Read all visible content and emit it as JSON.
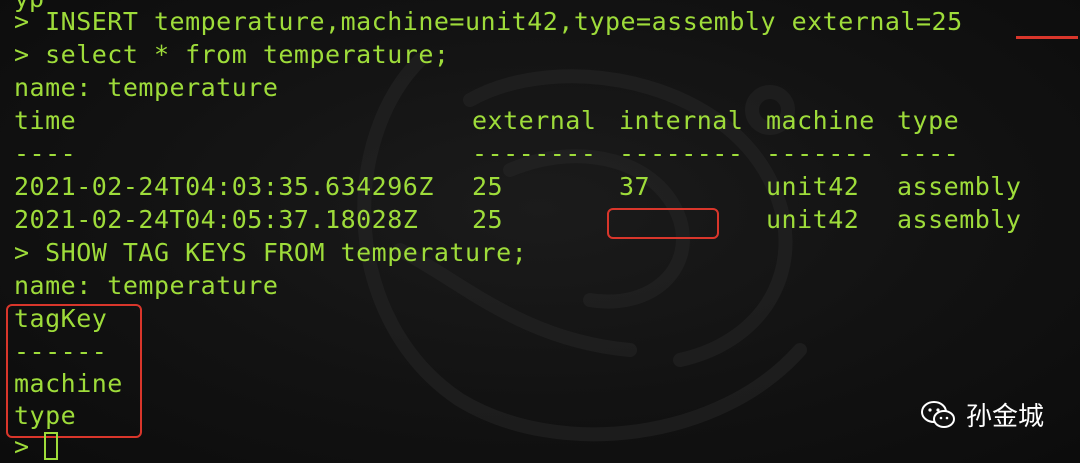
{
  "terminal": {
    "top_partial": "yp",
    "lines": {
      "insert": "> INSERT temperature,machine=unit42,type=assembly external=25",
      "select": "> select * from temperature;",
      "name1": "name: temperature",
      "show": "> SHOW TAG KEYS FROM temperature;",
      "name2": "name: temperature",
      "tagkey_header": "tagKey",
      "tagkey_sep": "------",
      "tagkey_row1": "machine",
      "tagkey_row2": "type",
      "prompt": ">"
    },
    "table": {
      "headers": {
        "time": "time",
        "external": "external",
        "internal": "internal",
        "machine": "machine",
        "type": "type"
      },
      "separators": {
        "time": "----",
        "external": "--------",
        "internal": "--------",
        "machine": "-------",
        "type": "----"
      },
      "rows": [
        {
          "time": "2021-02-24T04:03:35.634296Z",
          "external": "25",
          "internal": "37",
          "machine": "unit42",
          "type": "assembly"
        },
        {
          "time": "2021-02-24T04:05:37.18028Z",
          "external": "25",
          "internal": "",
          "machine": "unit42",
          "type": "assembly"
        }
      ]
    }
  },
  "brand": {
    "name": "孙金城",
    "icon": "wechat-icon"
  },
  "colors": {
    "background": "#111111",
    "text": "#9edc3a",
    "highlight": "#d9362b"
  }
}
